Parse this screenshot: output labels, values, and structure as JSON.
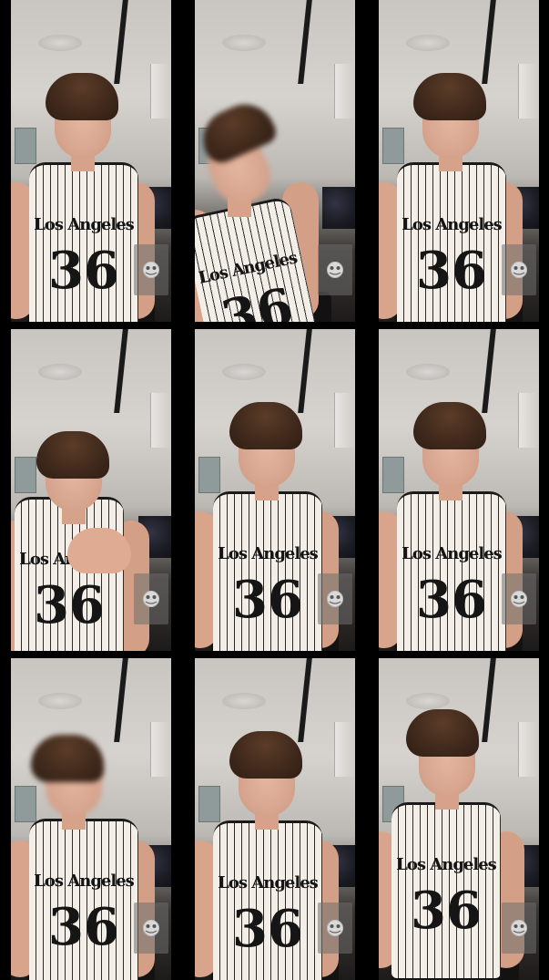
{
  "grid": {
    "rows": 3,
    "columns": 3
  },
  "colors": {
    "background": "#000000",
    "jersey_base": "#f3efe8",
    "jersey_stripe": "#2b2b2b",
    "hair": "#412a1c",
    "skin": "#d8a68f",
    "overlay_button": "#6e6e6e"
  },
  "jersey": {
    "team_text": "Los Angeles",
    "number": "36"
  },
  "tiles": [
    {
      "id": "frame-1",
      "overlay_icon": "gallery-icon",
      "pose": "normal"
    },
    {
      "id": "frame-2",
      "overlay_icon": "gallery-icon",
      "pose": "bent-over"
    },
    {
      "id": "frame-3",
      "overlay_icon": "gallery-icon",
      "pose": "normal"
    },
    {
      "id": "frame-4",
      "overlay_icon": "gallery-icon",
      "pose": "hands-raised"
    },
    {
      "id": "frame-5",
      "overlay_icon": "gallery-icon",
      "pose": "normal"
    },
    {
      "id": "frame-6",
      "overlay_icon": "gallery-icon",
      "pose": "normal"
    },
    {
      "id": "frame-7",
      "overlay_icon": "gallery-icon",
      "pose": "blurred"
    },
    {
      "id": "frame-8",
      "overlay_icon": "gallery-icon",
      "pose": "normal"
    },
    {
      "id": "frame-9",
      "overlay_icon": "gallery-icon",
      "pose": "close-up"
    }
  ]
}
